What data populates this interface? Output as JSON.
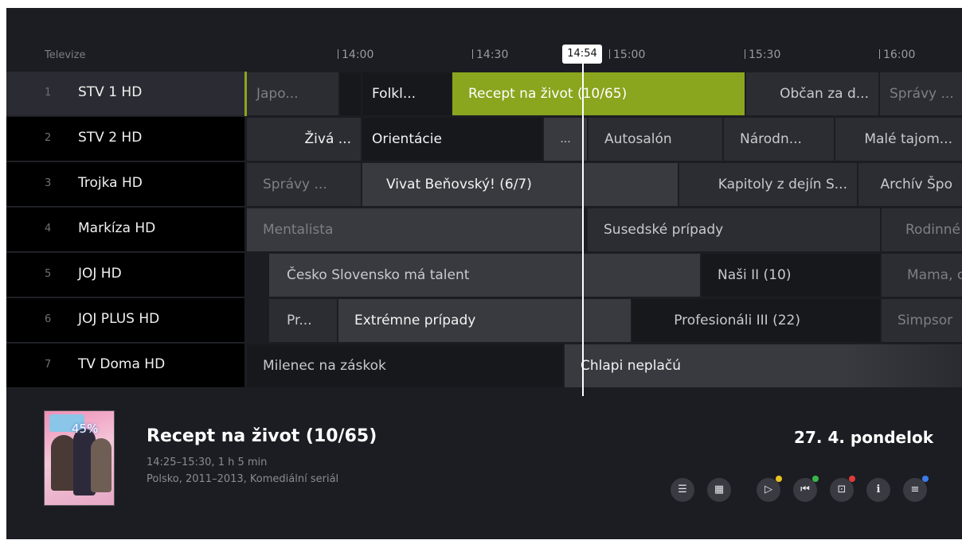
{
  "header": {
    "section_label": "Televize",
    "ticks": [
      "14:00",
      "14:30",
      "15:00",
      "15:30",
      "16:00"
    ],
    "now": "14:54"
  },
  "channels": [
    {
      "num": "1",
      "name": "STV 1 HD",
      "programs": [
        "Japo...",
        "Folkl...",
        "Recept na život (10/65)",
        "Občan za d...",
        "Správy ..."
      ]
    },
    {
      "num": "2",
      "name": "STV 2 HD",
      "programs": [
        "Živá ...",
        "Orientácie",
        "...",
        "Autosalón",
        "Národn...",
        "Malé tajom..."
      ]
    },
    {
      "num": "3",
      "name": "Trojka HD",
      "programs": [
        "Správy ...",
        "Vivat Beňovský! (6/7)",
        "Kapitoly z dejín S...",
        "Archív Špo"
      ]
    },
    {
      "num": "4",
      "name": "Markíza HD",
      "programs": [
        "Mentalista",
        "Susedské prípady",
        "Rodinné"
      ]
    },
    {
      "num": "5",
      "name": "JOJ HD",
      "programs": [
        "Česko Slovensko má talent",
        "Naši II (10)",
        "Mama, c"
      ]
    },
    {
      "num": "6",
      "name": "JOJ PLUS HD",
      "programs": [
        "Pr...",
        "Extrémne prípady",
        "Profesionáli III (22)",
        "Simpsor"
      ]
    },
    {
      "num": "7",
      "name": "TV Doma HD",
      "programs": [
        "Milenec na záskok",
        "Chlapi neplačú"
      ]
    }
  ],
  "info": {
    "progress_label": "45%",
    "title": "Recept na život (10/65)",
    "time": "14:25–15:30, 1 h 5 min",
    "meta": "Polsko, 2011–2013, Komediální seriál",
    "date": "27. 4. pondelok"
  },
  "buttons": [
    {
      "icon": "list-icon",
      "glyph": "☰",
      "dot": ""
    },
    {
      "icon": "calendar-icon",
      "glyph": "▦",
      "dot": ""
    },
    {
      "icon": "play-icon",
      "glyph": "▷",
      "dot": "#e8c21f"
    },
    {
      "icon": "restart-icon",
      "glyph": "⏮",
      "dot": "#39b54a"
    },
    {
      "icon": "record-icon",
      "glyph": "⊡",
      "dot": "#e33b3b"
    },
    {
      "icon": "info-icon",
      "glyph": "i",
      "dot": ""
    },
    {
      "icon": "menu-icon",
      "glyph": "≡",
      "dot": "#3a7be8"
    }
  ],
  "colors": {
    "accent": "#8aa51e",
    "background": "#1c1d22"
  }
}
